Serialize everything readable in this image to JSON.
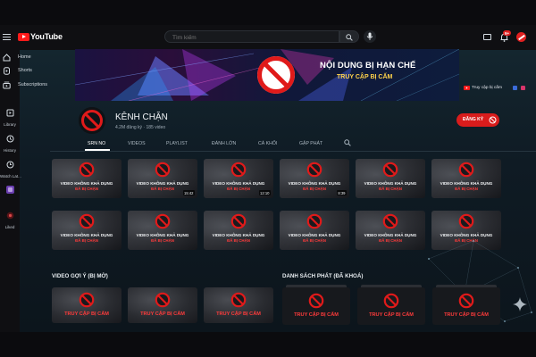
{
  "header": {
    "logo_text": "YouTube",
    "search_placeholder": "Tìm kiếm",
    "notification_count": "9+"
  },
  "sidebar": {
    "items": [
      {
        "label": "Home",
        "icon": "home-icon"
      },
      {
        "label": "Shorts",
        "icon": "shorts-icon"
      },
      {
        "label": "Subscriptions",
        "icon": "subscriptions-icon"
      }
    ],
    "compact": [
      {
        "label": "Library",
        "icon": "library-icon"
      },
      {
        "label": "History",
        "icon": "history-icon"
      },
      {
        "label": "Watch Lat...",
        "icon": "clock-icon"
      },
      {
        "label": "",
        "icon": "video-icon"
      },
      {
        "label": "Liked",
        "icon": "like-icon"
      }
    ]
  },
  "banner": {
    "title": "NỘI DUNG BỊ HẠN CHẾ",
    "subtitle": "TRUY CẬP BỊ CẤM",
    "link_text": "Truy cập bị cấm"
  },
  "channel": {
    "name": "KÊNH CHẶN",
    "meta": "4.2M đăng ký · 185 video",
    "subscribe_label": "ĐĂNG KÝ"
  },
  "tabs": [
    {
      "label": "SRN NO",
      "active": true
    },
    {
      "label": "VIDEOS",
      "active": false
    },
    {
      "label": "PLAYLIST",
      "active": false
    },
    {
      "label": "ĐÁNH LỚN",
      "active": false
    },
    {
      "label": "CÁ KHỐI",
      "active": false
    },
    {
      "label": "GẬP PHÁT",
      "active": false
    }
  ],
  "videos": {
    "line1": "VIDEO KHÔNG KHẢ DỤNG",
    "line2": "ĐÃ BỊ CHẶN",
    "durations": [
      "",
      "15:42",
      "12:10",
      "8:39",
      "",
      "",
      "",
      "",
      "",
      "",
      "",
      ""
    ]
  },
  "suggested": {
    "title": "VIDEO GỢI Ý (BỊ MỜ)",
    "label": "TRUY CẬP BỊ CẤM"
  },
  "playlists": {
    "title": "DANH SÁCH PHÁT (ĐÃ KHOÁ)",
    "label": "TRUY CẬP BỊ CẤM"
  },
  "colors": {
    "accent": "#d91c1c",
    "warning_text": "#ff3b3b",
    "banner_subtitle": "#ffd24a"
  }
}
